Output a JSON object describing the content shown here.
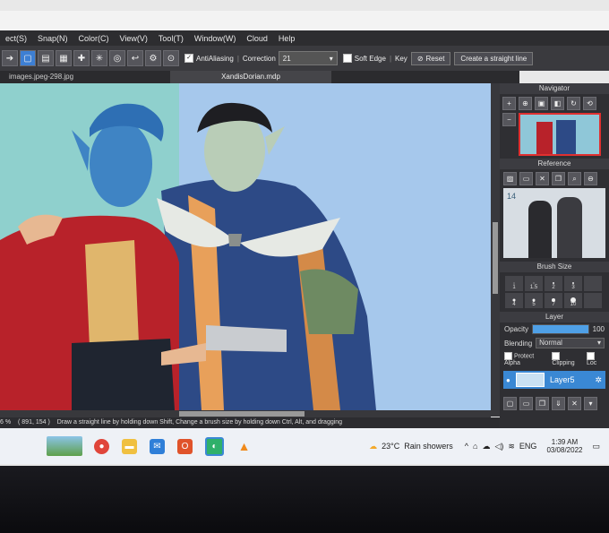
{
  "menu": [
    "ect(S)",
    "Snap(N)",
    "Color(C)",
    "View(V)",
    "Tool(T)",
    "Window(W)",
    "Cloud",
    "Help"
  ],
  "toolbar": {
    "antialiasing_label": "AntiAliasing",
    "correction_label": "Correction",
    "correction_value": "21",
    "soft_edge_label": "Soft Edge",
    "key_label": "Key",
    "reset_label": "Reset",
    "straight_line_label": "Create a straight line"
  },
  "tabs": {
    "inactive": "images.jpeg-298.jpg",
    "active": "XandisDorian.mdp"
  },
  "panels": {
    "navigator_title": "Navigator",
    "reference_title": "Reference",
    "reference_number": "14",
    "brush_size_title": "Brush Size",
    "brush_sizes": [
      "1",
      "1.5",
      "2",
      "3",
      "4",
      "5",
      "7",
      "10"
    ],
    "layer_title": "Layer",
    "opacity_label": "Opacity",
    "opacity_value": "100",
    "opacity_fraction": 1.0,
    "blending_label": "Blending",
    "blending_value": "Normal",
    "protect_alpha_label": "Protect Alpha",
    "clipping_label": "Clipping",
    "lock_label": "Loc",
    "layer_name": "Layer5"
  },
  "status": {
    "zoom": "6 %",
    "coords": "( 891, 154 )",
    "hint": "Draw a straight line by holding down Shift, Change a brush size by holding down Ctrl, Alt, and dragging"
  },
  "taskbar": {
    "temperature": "23°C",
    "weather": "Rain showers",
    "language": "ENG",
    "time": "1:39 AM",
    "date": "03/08/2022"
  },
  "colors": {
    "accent": "#3a88d4",
    "canvas_bg": "#9fc3e6",
    "panel_bg": "#2f2f33"
  }
}
